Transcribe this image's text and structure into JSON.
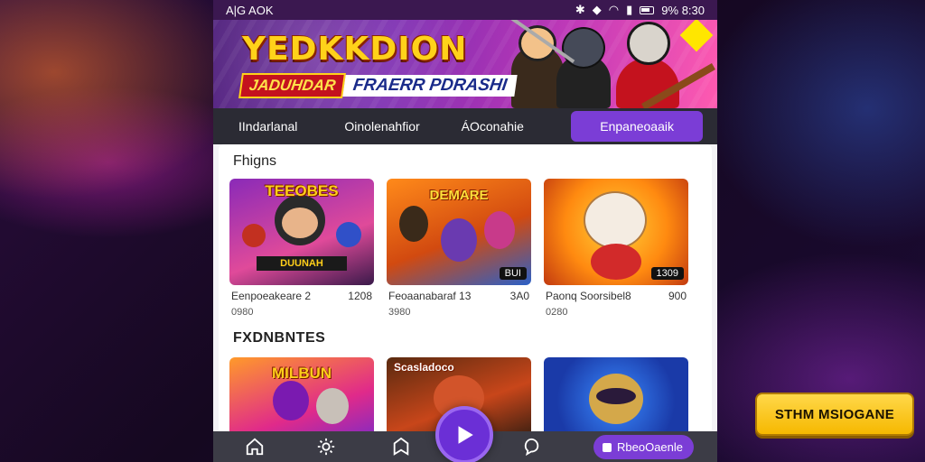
{
  "status": {
    "left": "A|G AOK",
    "time": "9% 8:30"
  },
  "banner": {
    "title": "YEDKKDION",
    "sub_tag": "JADUHDAR",
    "sub_text": "FRAERR PDRASHI"
  },
  "tabs": [
    {
      "label": "IIndarlanal"
    },
    {
      "label": "Oinolenahfior"
    },
    {
      "label": "ÁOconahie"
    },
    {
      "label": "Enpaneoaaik",
      "active": true
    }
  ],
  "sections": [
    {
      "title": "Fhigns",
      "cards": [
        {
          "thumb_title": "TEEOBES",
          "strip": "DUUNAH",
          "badge": "",
          "name": "Eenpoeakeare 2",
          "count": "1208",
          "sub": "0980"
        },
        {
          "thumb_title": "DEMARE",
          "strip": "",
          "badge": "BUI",
          "name": "Feoaanabaraf 13",
          "count": "3A0",
          "sub": "3980"
        },
        {
          "thumb_title": "",
          "strip": "",
          "badge": "1309",
          "name": "Paonq Soorsibel8",
          "count": "900",
          "sub": "0280"
        }
      ]
    },
    {
      "title": "FXDNBNTES",
      "cards": [
        {
          "thumb_title": "MILBUN",
          "strip": "",
          "badge": "",
          "name": "",
          "count": "",
          "sub": ""
        },
        {
          "thumb_title": "Scasladoco",
          "strip": "",
          "badge": "",
          "name": "",
          "count": "",
          "sub": ""
        },
        {
          "thumb_title": "",
          "strip": "",
          "badge": "",
          "name": "",
          "count": "",
          "sub": ""
        }
      ]
    }
  ],
  "navbar": {
    "pill_label": "RbeoOaenle"
  },
  "cta": {
    "label": "STHM MSIOGANE"
  },
  "colors": {
    "accent": "#7b3dd6",
    "cta": "#f6b800",
    "statusbar": "#3b1850"
  },
  "icons": [
    "home-icon",
    "settings-icon",
    "bookmark-icon",
    "play-icon",
    "chat-icon"
  ]
}
